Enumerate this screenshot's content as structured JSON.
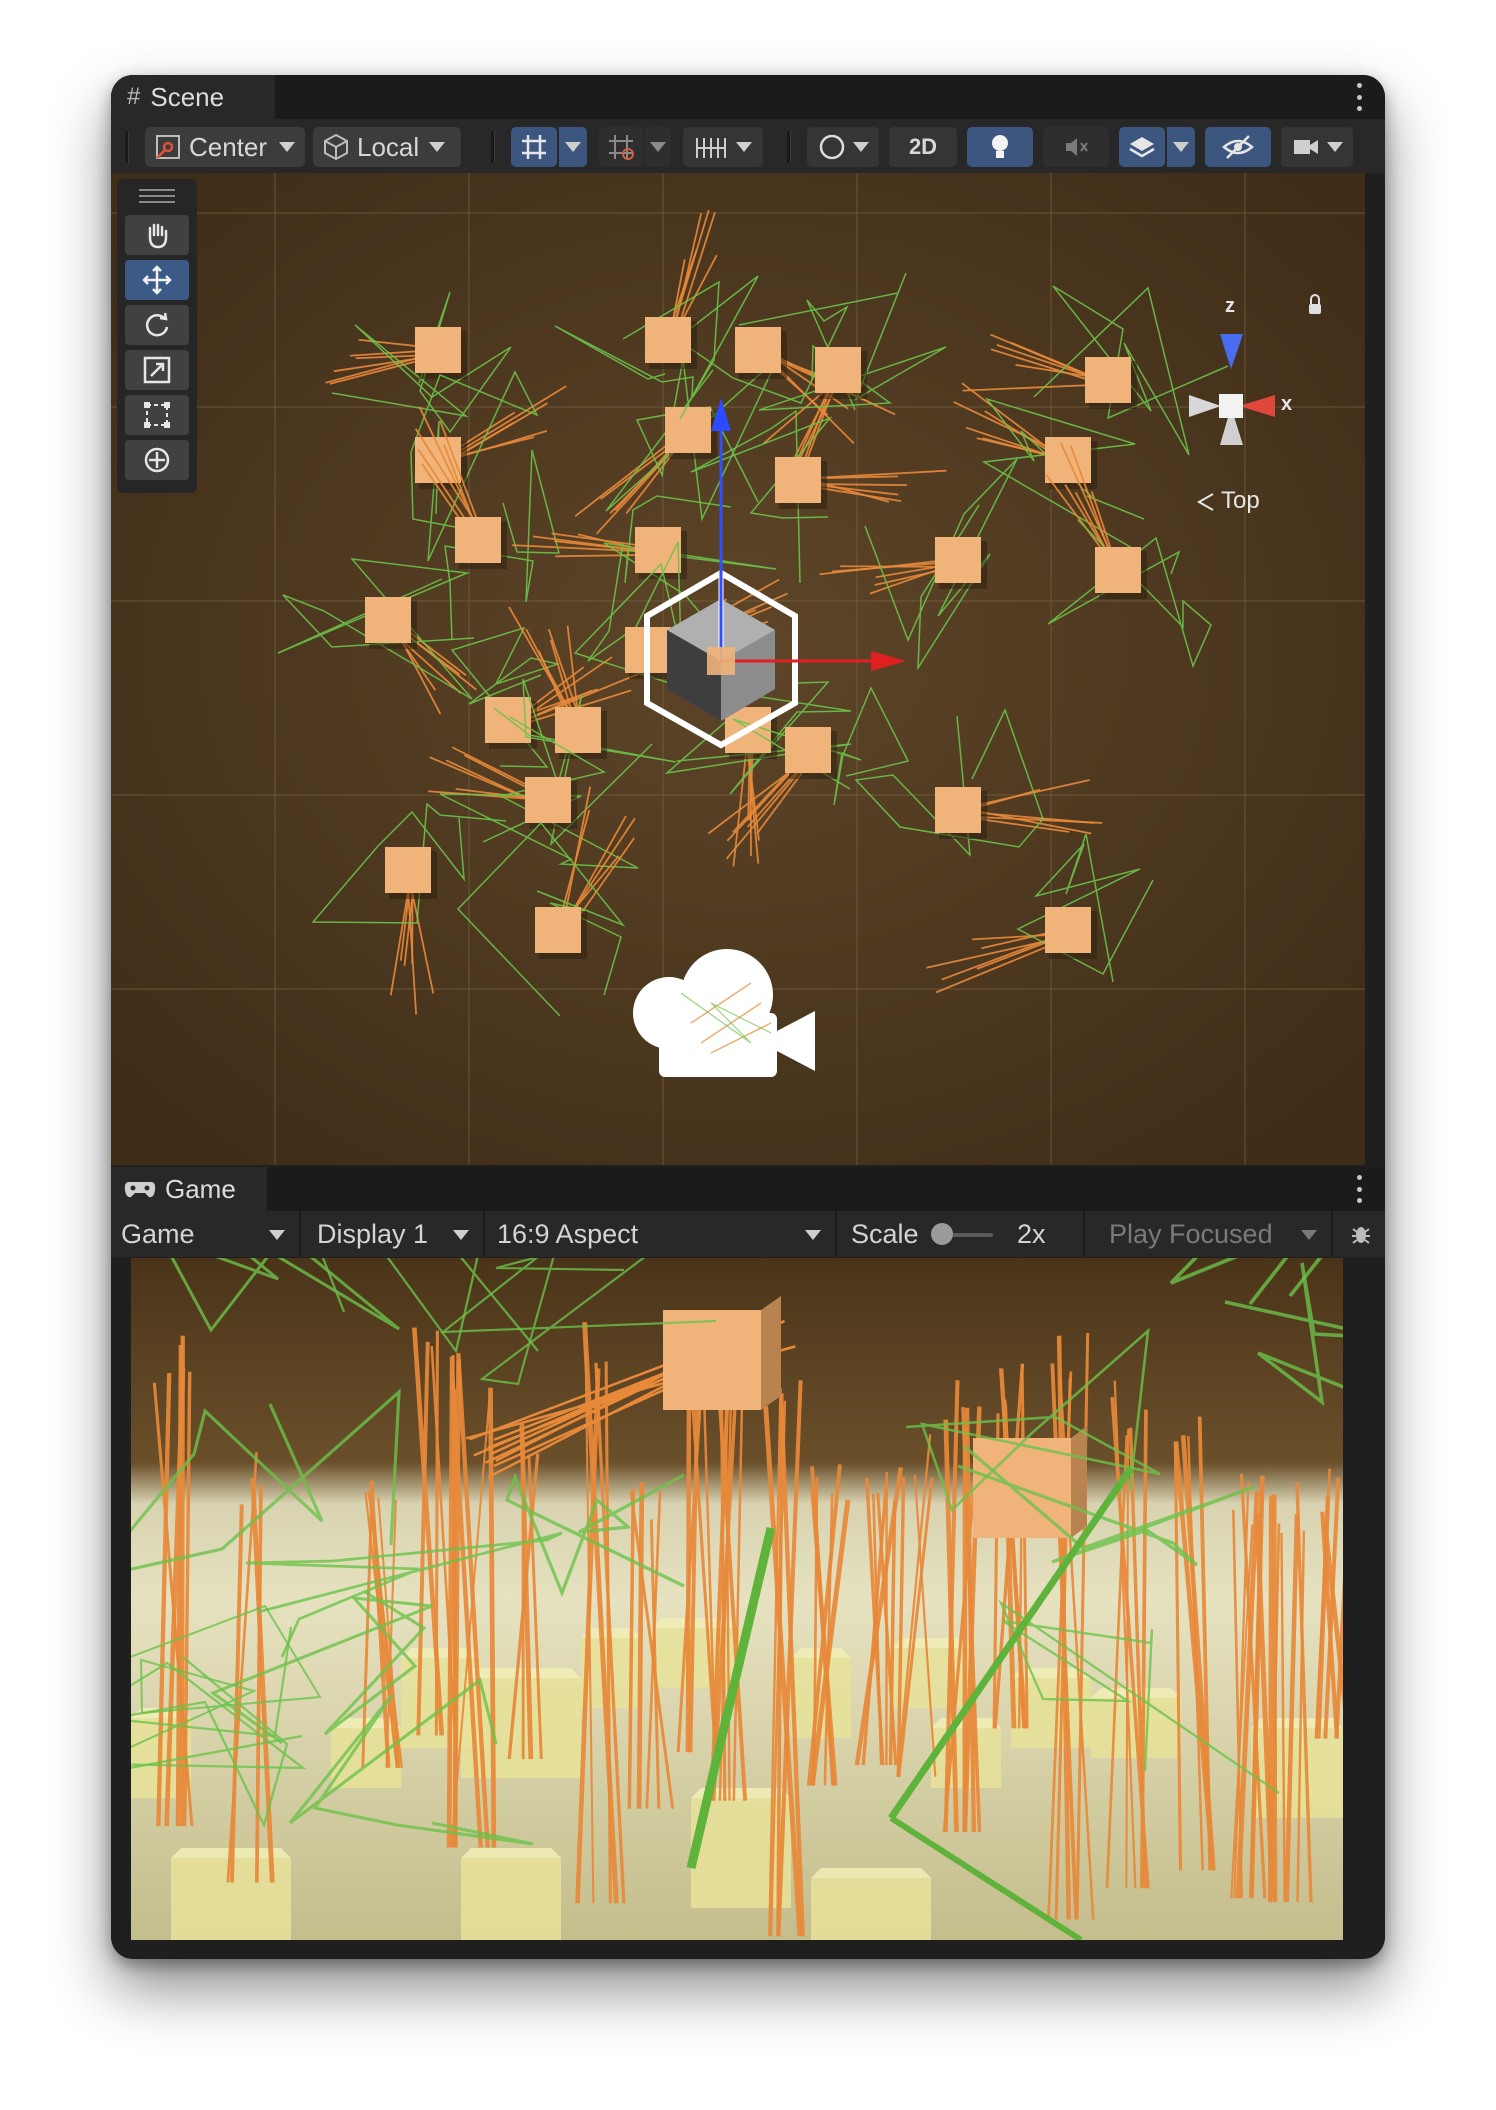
{
  "scene": {
    "tab_label": "Scene",
    "tab_icon": "grid-hash-icon",
    "toolbar": {
      "pivot_label": "Center",
      "handle_label": "Local",
      "mode_2d_label": "2D"
    },
    "tools": [
      "hand-tool",
      "move-tool",
      "rotate-tool",
      "scale-tool",
      "rect-tool",
      "transform-tool"
    ],
    "active_tool": "move-tool",
    "gizmo": {
      "axis_z": "z",
      "axis_x": "x",
      "view_label": "Top"
    }
  },
  "game": {
    "tab_label": "Game",
    "tab_icon": "gamepad-icon",
    "view_dropdown": "Game",
    "display_dropdown": "Display 1",
    "aspect_dropdown": "16:9 Aspect",
    "scale_label": "Scale",
    "scale_value": "2x",
    "play_mode_dropdown": "Play Focused"
  },
  "colors": {
    "scene_ground": "#4f3a22",
    "toolbar_bg": "#282828",
    "active_blue": "#3c5680",
    "orange_branch": "#e8893a",
    "green_leaf": "#6cc24a",
    "cube_peach": "#f0b47a"
  }
}
